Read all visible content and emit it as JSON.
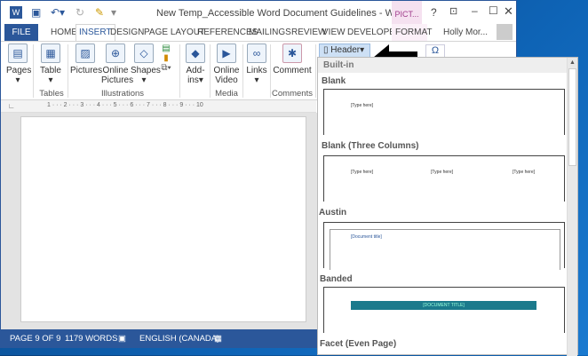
{
  "window": {
    "title": "New Temp_Accessible Word Document Guidelines - Word",
    "contextual_tab": "PICT...",
    "help": "?",
    "user": "Holly Mor..."
  },
  "tabs": [
    "FILE",
    "HOME",
    "INSERT",
    "DESIGN",
    "PAGE LAYOUT",
    "REFERENCES",
    "MAILINGS",
    "REVIEW",
    "VIEW",
    "DEVELOPER",
    "FORMAT"
  ],
  "ribbon": {
    "pages": "Pages",
    "table": "Table",
    "tables_group": "Tables",
    "pictures": "Pictures",
    "online_pictures_1": "Online",
    "online_pictures_2": "Pictures",
    "shapes": "Shapes",
    "illustrations_group": "Illustrations",
    "addins_1": "Add-",
    "addins_2": "ins",
    "online_video_1": "Online",
    "online_video_2": "Video",
    "media_group": "Media",
    "links": "Links",
    "comment": "Comment",
    "comments_group": "Comments",
    "header": "Header",
    "symbol": "Ω"
  },
  "ruler": "1 · · · 2 · · · 3 · · · 4 · · · 5 · · · 6 · · · 7 · · · 8 · · · 9 · · · 10",
  "status": {
    "page": "PAGE 9 OF 9",
    "words": "1179 WORDS",
    "language": "ENGLISH (CANADA)"
  },
  "dropdown": {
    "section": "Built-in",
    "items": [
      {
        "name": "Blank",
        "placeholders": [
          "[Type here]"
        ]
      },
      {
        "name": "Blank (Three Columns)",
        "placeholders": [
          "[Type here]",
          "[Type here]",
          "[Type here]"
        ]
      },
      {
        "name": "Austin",
        "placeholders": [
          "[Document title]"
        ]
      },
      {
        "name": "Banded",
        "placeholders": [
          "[DOCUMENT TITLE]"
        ]
      },
      {
        "name": "Facet (Even Page)",
        "placeholders": []
      }
    ]
  },
  "colors": {
    "word_blue": "#2b579a",
    "banded_teal": "#1b7a8c",
    "contextual_pink": "#f5e1f0"
  }
}
